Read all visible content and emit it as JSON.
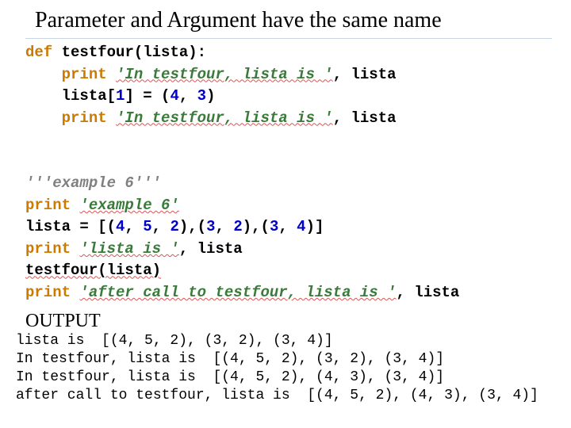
{
  "title": "Parameter and Argument have the same name",
  "code": {
    "def": "def",
    "fn_name": "testfour",
    "param": "lista",
    "print_kw": "print",
    "str_in1": "'In testfour, lista is '",
    "lista_id": "lista",
    "idx_open": "lista[",
    "idx_num": "1",
    "idx_close": "] = (",
    "tuple_a": "4",
    "tuple_b": "3",
    "close_paren": ")",
    "docstr": "'''example 6'''",
    "str_ex6": "'example 6'",
    "assign_head": "lista = [(",
    "v1": "4",
    "v2": "5",
    "v3": "2",
    "v4": "3",
    "v5": "2",
    "v6": "3",
    "v7": "4",
    "mid1": ", ",
    "mid_close": "),(",
    "end_list": ")]",
    "str_listais": "'lista is '",
    "call": "testfour(lista)",
    "str_after": "'after call to testfour, lista is '"
  },
  "output_label": "OUTPUT",
  "output": {
    "l1": "lista is  [(4, 5, 2), (3, 2), (3, 4)]",
    "l2": "In testfour, lista is  [(4, 5, 2), (3, 2), (3, 4)]",
    "l3": "In testfour, lista is  [(4, 5, 2), (4, 3), (3, 4)]",
    "l4": "after call to testfour, lista is  [(4, 5, 2), (4, 3), (3, 4)]"
  }
}
